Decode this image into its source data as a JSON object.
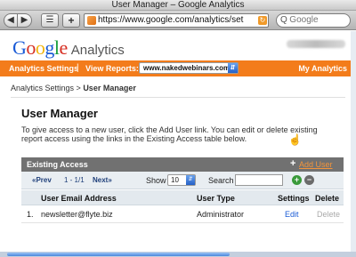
{
  "browser": {
    "window_title": "User Manager – Google Analytics",
    "url": "https://www.google.com/analytics/set",
    "search_placeholder": "Google",
    "back_glyph": "◀",
    "forward_glyph": "▶",
    "plus_glyph": "+",
    "magnifier_glyph": "Q"
  },
  "header": {
    "logo_letters": [
      "G",
      "o",
      "o",
      "g",
      "l",
      "e"
    ],
    "logo_suffix": "Analytics"
  },
  "nav": {
    "settings_label": "Analytics Settings",
    "separator": "|",
    "reports_label": "View Reports:",
    "selected_site": "www.nakedwebinars.com",
    "my_analytics_label": "My Analytics"
  },
  "breadcrumb": {
    "parent": "Analytics Settings",
    "separator": " > ",
    "current": "User Manager"
  },
  "main": {
    "title": "User Manager",
    "description": "To give access to a new user, click the Add User link. You can edit or delete existing report access using the links in the Existing Access table below."
  },
  "access_box": {
    "title": "Existing Access",
    "add_plus": "+",
    "add_user_label": "Add User",
    "pager": {
      "prev_label": "«Prev",
      "range": "1 - 1/1",
      "next_label": "Next»",
      "show_label": "Show",
      "show_value": "10",
      "search_label": "Search",
      "plus_glyph": "+",
      "minus_glyph": "−"
    },
    "columns": {
      "email": "User Email Address",
      "type": "User Type",
      "settings": "Settings",
      "delete": "Delete"
    },
    "rows": [
      {
        "num": "1.",
        "email": "newsletter@flyte.biz",
        "type": "Administrator",
        "edit": "Edit",
        "delete": "Delete"
      }
    ]
  },
  "colors": {
    "nav_orange": "#f37c1b",
    "add_user_orange": "#f3943b",
    "link_blue": "#1a5bd6"
  }
}
